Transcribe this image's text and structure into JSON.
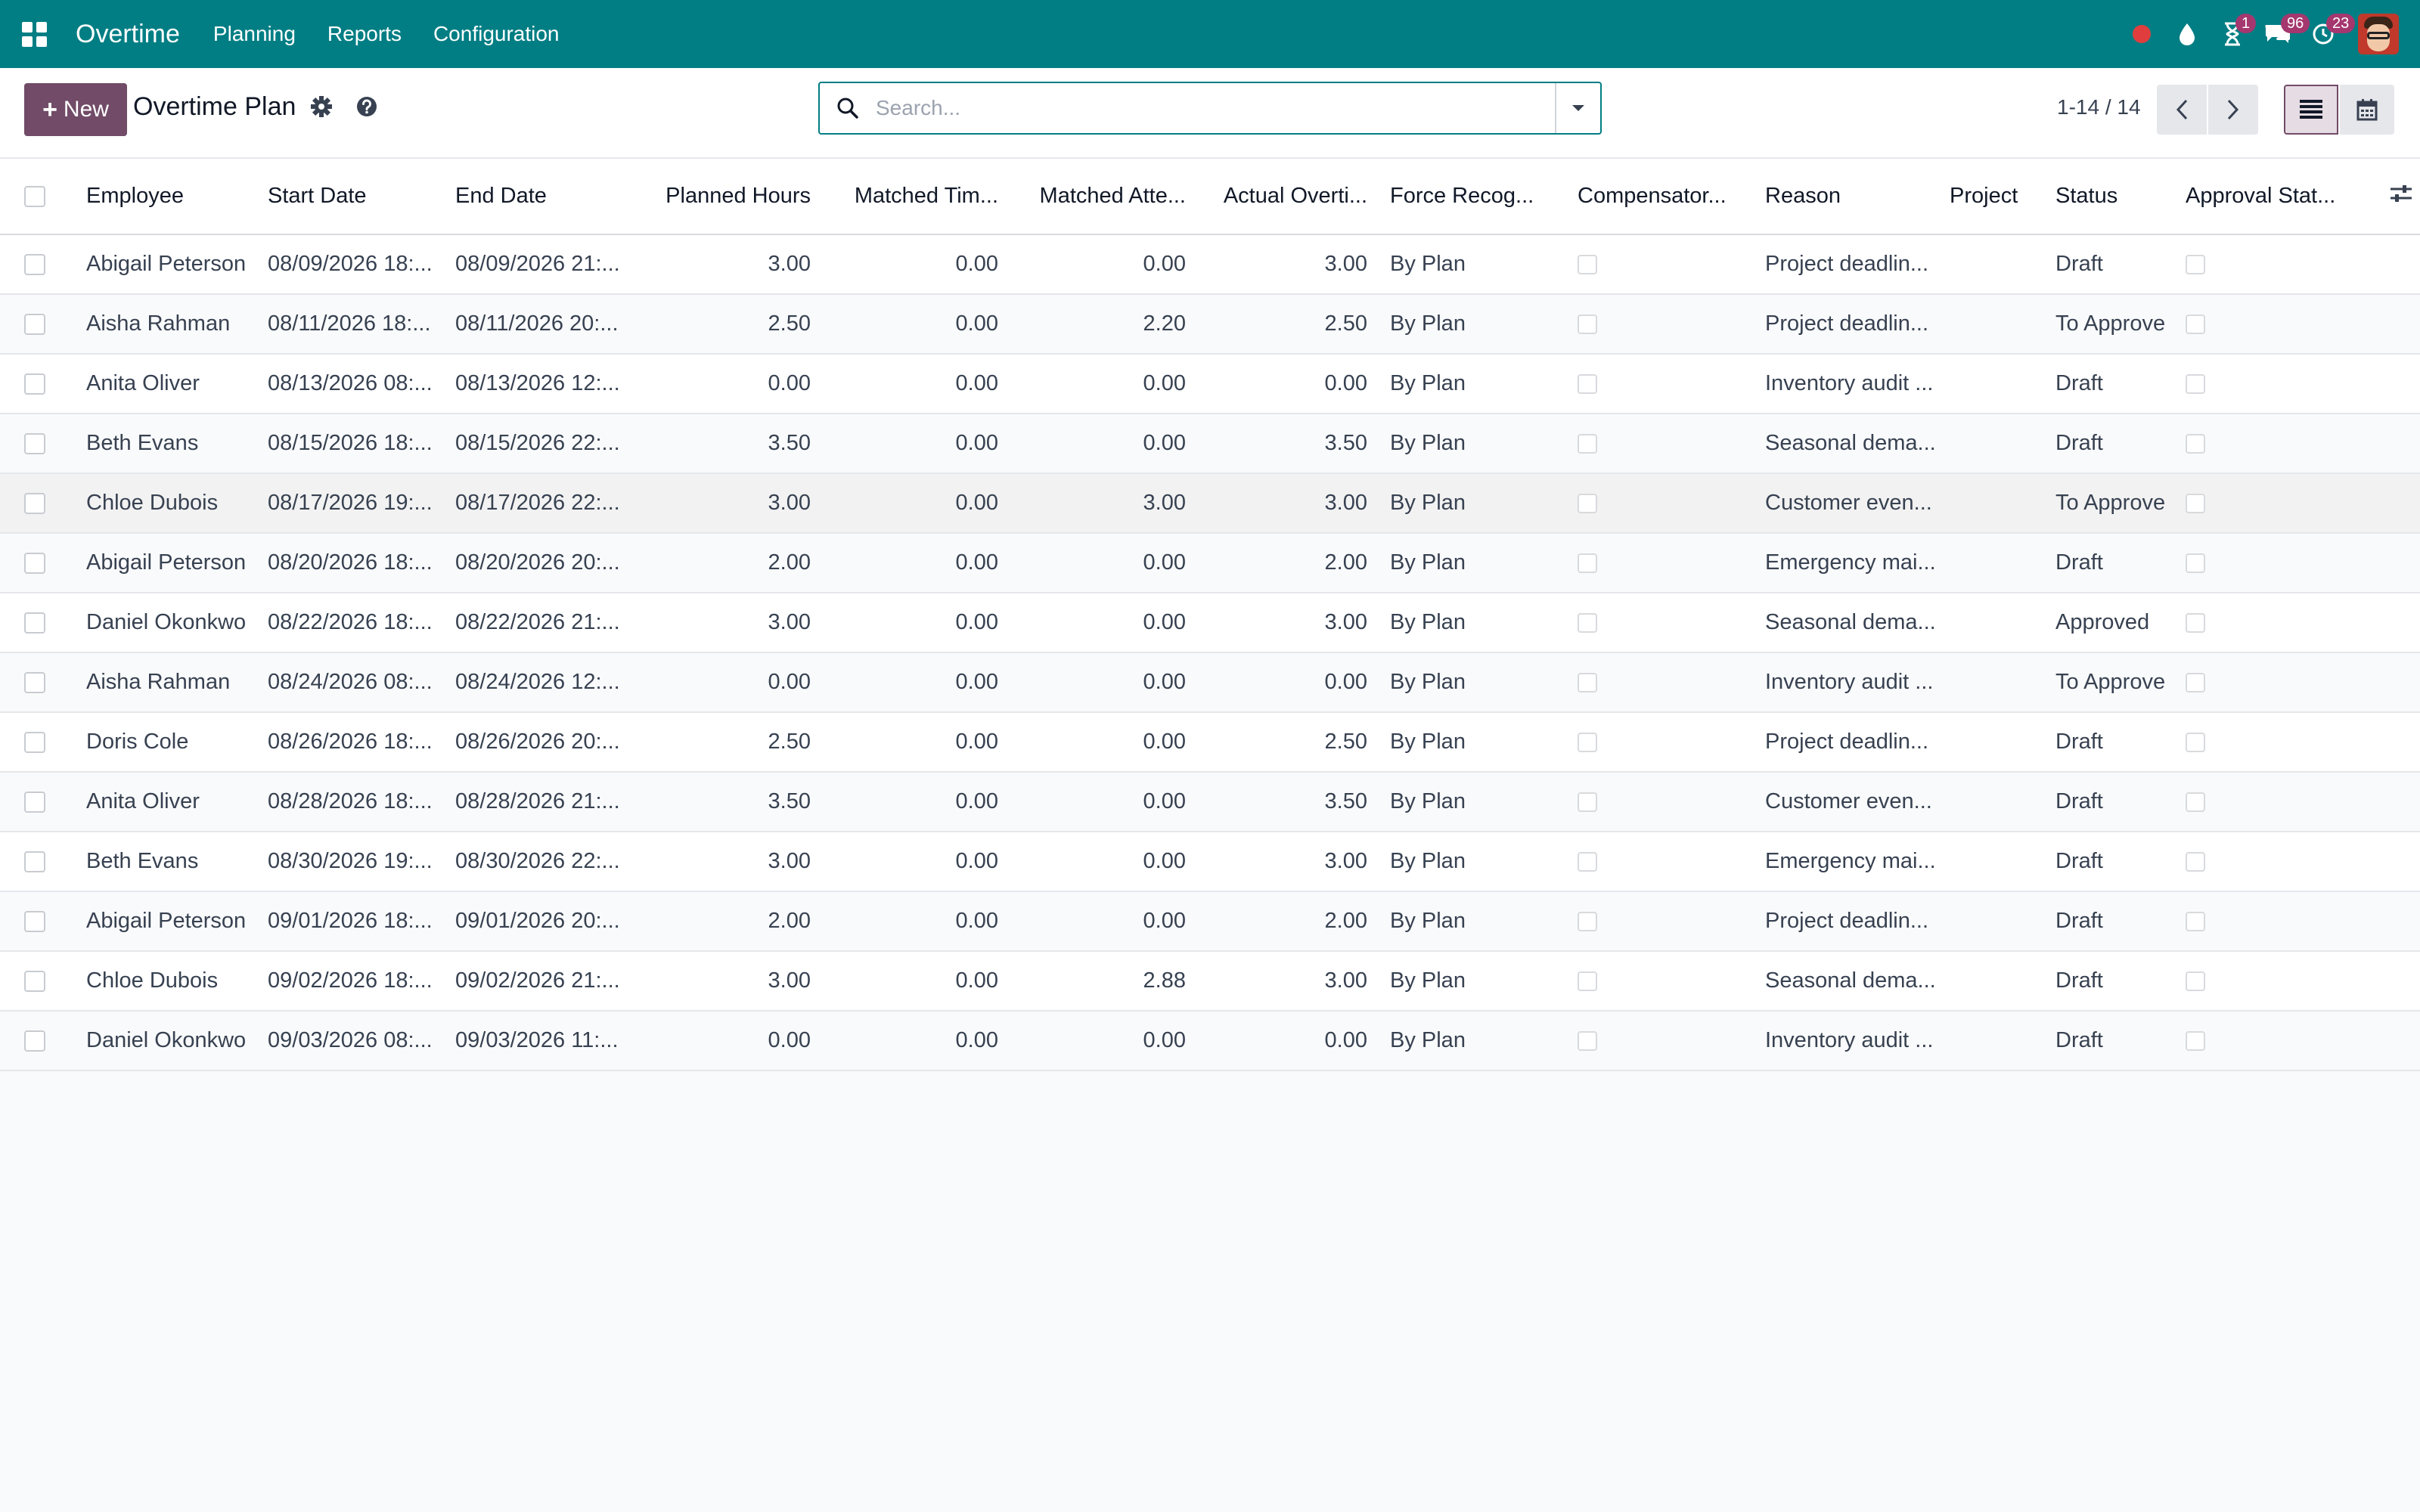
{
  "navbar": {
    "app_name": "Overtime",
    "menu": [
      "Planning",
      "Reports",
      "Configuration"
    ],
    "activity_badge": "1",
    "messages_badge": "96",
    "followup_badge": "23",
    "colors": {
      "navbar_bg": "#017e84",
      "badge_bg": "#a5376f",
      "status_dot": "#e03e3e"
    }
  },
  "control_panel": {
    "new_label": "New",
    "title": "Overtime Plan",
    "search_placeholder": "Search...",
    "pager": "1-14 / 14"
  },
  "table": {
    "columns": [
      "Employee",
      "Start Date",
      "End Date",
      "Planned Hours",
      "Matched Tim...",
      "Matched Atte...",
      "Actual Overti...",
      "Force Recog...",
      "Compensator...",
      "Reason",
      "Project",
      "Status",
      "Approval Stat..."
    ],
    "rows": [
      {
        "employee": "Abigail Peterson",
        "start": "08/09/2026 18:...",
        "end": "08/09/2026 21:...",
        "planned": "3.00",
        "matched_time": "0.00",
        "matched_att": "0.00",
        "actual": "3.00",
        "force": "By Plan",
        "reason": "Project deadlin...",
        "project": "",
        "status": "Draft"
      },
      {
        "employee": "Aisha Rahman",
        "start": "08/11/2026 18:...",
        "end": "08/11/2026 20:...",
        "planned": "2.50",
        "matched_time": "0.00",
        "matched_att": "2.20",
        "actual": "2.50",
        "force": "By Plan",
        "reason": "Project deadlin...",
        "project": "",
        "status": "To Approve"
      },
      {
        "employee": "Anita Oliver",
        "start": "08/13/2026 08:...",
        "end": "08/13/2026 12:...",
        "planned": "0.00",
        "matched_time": "0.00",
        "matched_att": "0.00",
        "actual": "0.00",
        "force": "By Plan",
        "reason": "Inventory audit ...",
        "project": "",
        "status": "Draft"
      },
      {
        "employee": "Beth Evans",
        "start": "08/15/2026 18:...",
        "end": "08/15/2026 22:...",
        "planned": "3.50",
        "matched_time": "0.00",
        "matched_att": "0.00",
        "actual": "3.50",
        "force": "By Plan",
        "reason": "Seasonal dema...",
        "project": "",
        "status": "Draft"
      },
      {
        "employee": "Chloe Dubois",
        "start": "08/17/2026 19:...",
        "end": "08/17/2026 22:...",
        "planned": "3.00",
        "matched_time": "0.00",
        "matched_att": "3.00",
        "actual": "3.00",
        "force": "By Plan",
        "reason": "Customer even...",
        "project": "",
        "status": "To Approve"
      },
      {
        "employee": "Abigail Peterson",
        "start": "08/20/2026 18:...",
        "end": "08/20/2026 20:...",
        "planned": "2.00",
        "matched_time": "0.00",
        "matched_att": "0.00",
        "actual": "2.00",
        "force": "By Plan",
        "reason": "Emergency mai...",
        "project": "",
        "status": "Draft"
      },
      {
        "employee": "Daniel Okonkwo",
        "start": "08/22/2026 18:...",
        "end": "08/22/2026 21:...",
        "planned": "3.00",
        "matched_time": "0.00",
        "matched_att": "0.00",
        "actual": "3.00",
        "force": "By Plan",
        "reason": "Seasonal dema...",
        "project": "",
        "status": "Approved"
      },
      {
        "employee": "Aisha Rahman",
        "start": "08/24/2026 08:...",
        "end": "08/24/2026 12:...",
        "planned": "0.00",
        "matched_time": "0.00",
        "matched_att": "0.00",
        "actual": "0.00",
        "force": "By Plan",
        "reason": "Inventory audit ...",
        "project": "",
        "status": "To Approve"
      },
      {
        "employee": "Doris Cole",
        "start": "08/26/2026 18:...",
        "end": "08/26/2026 20:...",
        "planned": "2.50",
        "matched_time": "0.00",
        "matched_att": "0.00",
        "actual": "2.50",
        "force": "By Plan",
        "reason": "Project deadlin...",
        "project": "",
        "status": "Draft"
      },
      {
        "employee": "Anita Oliver",
        "start": "08/28/2026 18:...",
        "end": "08/28/2026 21:...",
        "planned": "3.50",
        "matched_time": "0.00",
        "matched_att": "0.00",
        "actual": "3.50",
        "force": "By Plan",
        "reason": "Customer even...",
        "project": "",
        "status": "Draft"
      },
      {
        "employee": "Beth Evans",
        "start": "08/30/2026 19:...",
        "end": "08/30/2026 22:...",
        "planned": "3.00",
        "matched_time": "0.00",
        "matched_att": "0.00",
        "actual": "3.00",
        "force": "By Plan",
        "reason": "Emergency mai...",
        "project": "",
        "status": "Draft"
      },
      {
        "employee": "Abigail Peterson",
        "start": "09/01/2026 18:...",
        "end": "09/01/2026 20:...",
        "planned": "2.00",
        "matched_time": "0.00",
        "matched_att": "0.00",
        "actual": "2.00",
        "force": "By Plan",
        "reason": "Project deadlin...",
        "project": "",
        "status": "Draft"
      },
      {
        "employee": "Chloe Dubois",
        "start": "09/02/2026 18:...",
        "end": "09/02/2026 21:...",
        "planned": "3.00",
        "matched_time": "0.00",
        "matched_att": "2.88",
        "actual": "3.00",
        "force": "By Plan",
        "reason": "Seasonal dema...",
        "project": "",
        "status": "Draft"
      },
      {
        "employee": "Daniel Okonkwo",
        "start": "09/03/2026 08:...",
        "end": "09/03/2026 11:...",
        "planned": "0.00",
        "matched_time": "0.00",
        "matched_att": "0.00",
        "actual": "0.00",
        "force": "By Plan",
        "reason": "Inventory audit ...",
        "project": "",
        "status": "Draft"
      }
    ]
  }
}
